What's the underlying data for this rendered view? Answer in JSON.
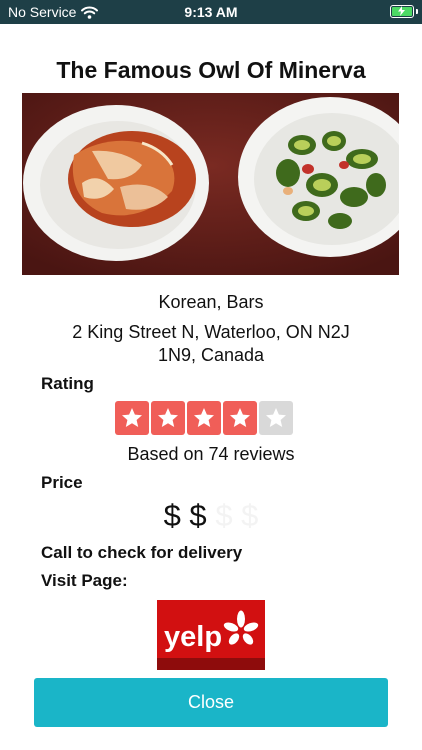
{
  "status_bar": {
    "carrier": "No Service",
    "time": "9:13 AM"
  },
  "restaurant": {
    "name": "The Famous Owl Of Minerva",
    "categories": "Korean, Bars",
    "address": "2 King Street N, Waterloo, ON N2J 1N9, Canada"
  },
  "rating": {
    "label": "Rating",
    "stars": 4,
    "max_stars": 5,
    "reviews_text": "Based on 74 reviews"
  },
  "price": {
    "label": "Price",
    "active": "$ $",
    "inactive": "$ $",
    "level": 2,
    "max_level": 4
  },
  "delivery_text": "Call to check for delivery",
  "visit_label": "Visit Page:",
  "yelp_logo_text": "yelp",
  "close_label": "Close",
  "colors": {
    "status_bar": "#1e3f47",
    "star_on": "#f05e58",
    "star_off": "#d9d9d9",
    "yelp_red": "#d21011",
    "close_button": "#1ab5c8"
  }
}
